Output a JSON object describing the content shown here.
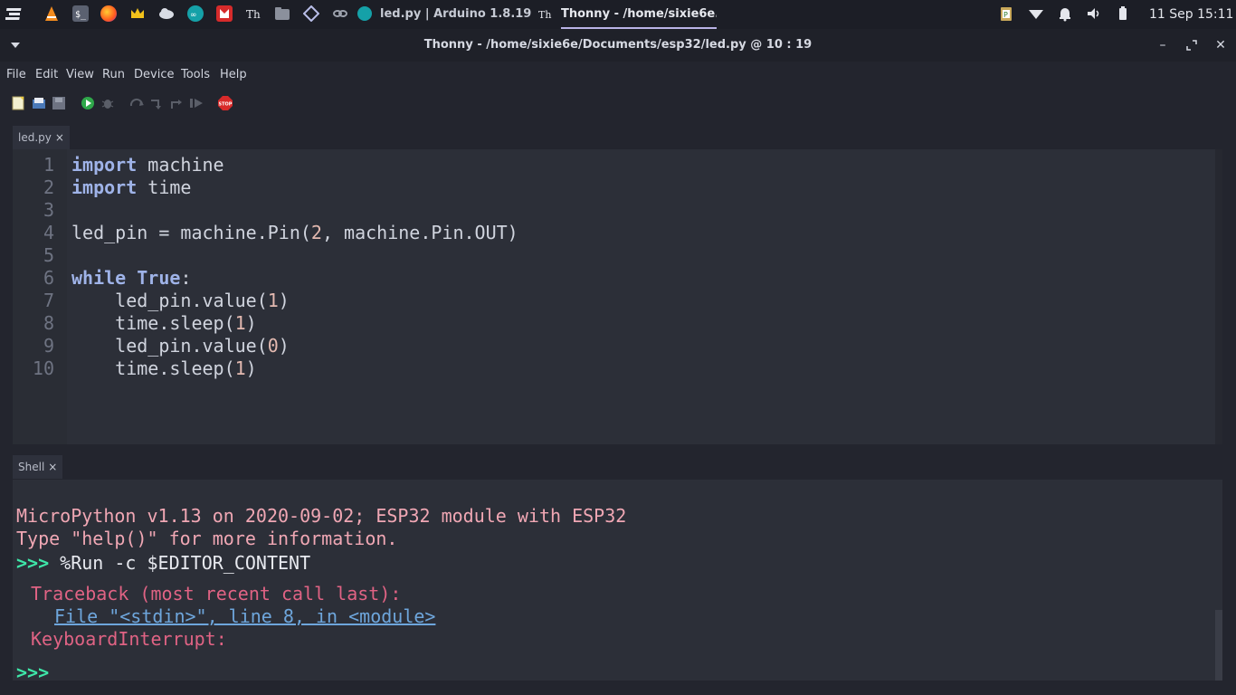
{
  "taskbar": {
    "tasks": [
      {
        "label": "led.py | Arduino 1.8.19"
      },
      {
        "label": "Thonny  -  /home/sixie6e..."
      }
    ],
    "clock": "11 Sep 15:11"
  },
  "window": {
    "title": "Thonny  -  /home/sixie6e/Documents/esp32/led.py  @  10 : 19"
  },
  "menu": [
    "File",
    "Edit",
    "View",
    "Run",
    "Device",
    "Tools",
    "Help"
  ],
  "toolbar": {
    "stop_label": "STOP"
  },
  "editor": {
    "tab_label": "led.py",
    "line_numbers": [
      "1",
      "2",
      "3",
      "4",
      "5",
      "6",
      "7",
      "8",
      "9",
      "10"
    ],
    "lines": [
      {
        "kw": "import",
        "rest": " machine"
      },
      {
        "kw": "import",
        "rest": " time"
      },
      {
        "kw": "",
        "rest": ""
      },
      {
        "pre": "led_pin = machine.Pin(",
        "num": "2",
        "post": ", machine.Pin.OUT)"
      },
      {
        "kw": "",
        "rest": ""
      },
      {
        "kw": "while",
        "kw2": "True",
        "rest": ":"
      },
      {
        "pre": "    led_pin.value(",
        "num": "1",
        "post": ")"
      },
      {
        "pre": "    time.sleep(",
        "num": "1",
        "post": ")"
      },
      {
        "pre": "    led_pin.value(",
        "num": "0",
        "post": ")"
      },
      {
        "pre": "    time.sleep(",
        "num": "1",
        "post": ")"
      }
    ]
  },
  "shell": {
    "tab_label": "Shell",
    "banner1": "MicroPython v1.13 on 2020-09-02; ESP32 module with ESP32",
    "banner2": "Type \"help()\" for more information.",
    "prompt": ">>>",
    "command": " %Run -c $EDITOR_CONTENT",
    "traceback": "Traceback (most recent call last):",
    "file_link": "File \"<stdin>\", line 8, in <module>",
    "error": "KeyboardInterrupt:",
    "prompt2": ">>>"
  },
  "colors": {
    "accent_green": "#3ee6a8",
    "error_red": "#e06384",
    "keyword_blue": "#9fb3e8"
  }
}
